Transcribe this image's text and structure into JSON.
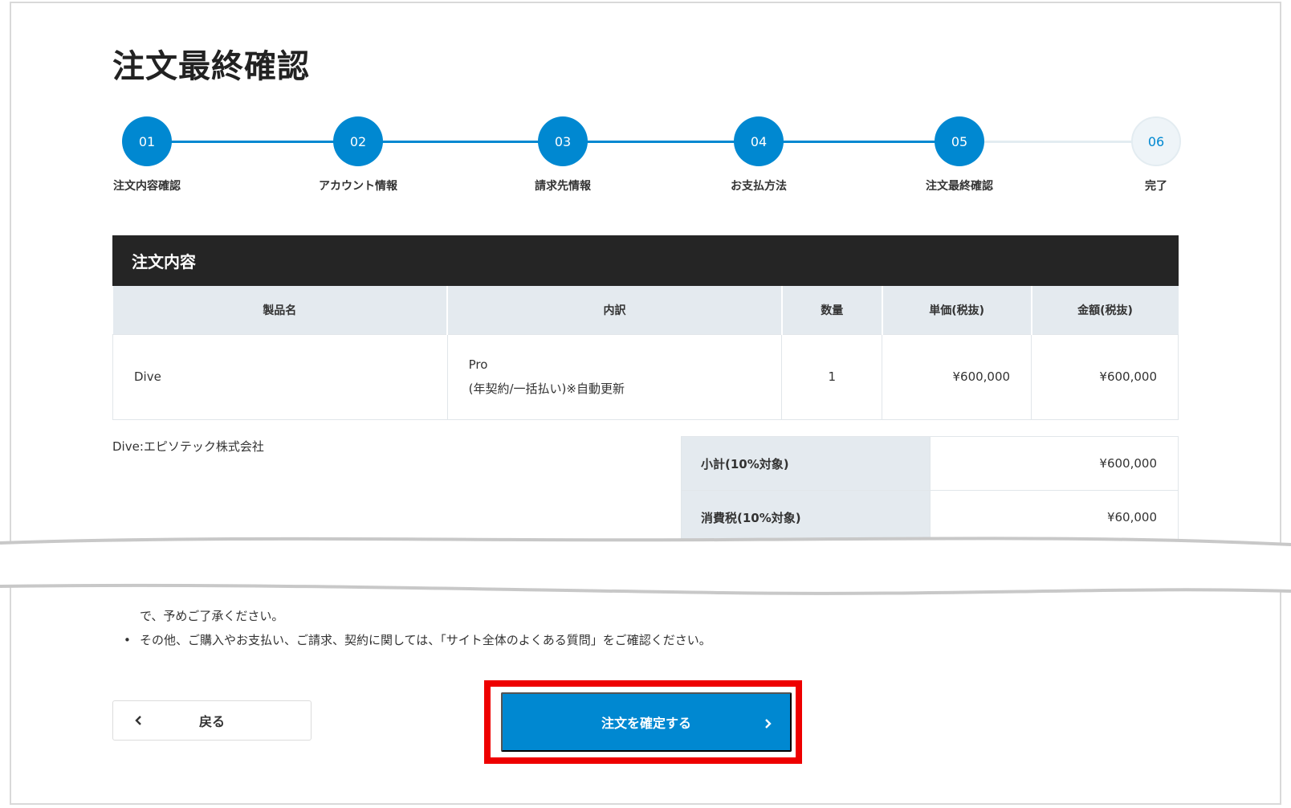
{
  "page": {
    "title": "注文最終確認"
  },
  "steps": [
    {
      "num": "01",
      "label": "注文内容確認",
      "state": "done"
    },
    {
      "num": "02",
      "label": "アカウント情報",
      "state": "done"
    },
    {
      "num": "03",
      "label": "請求先情報",
      "state": "done"
    },
    {
      "num": "04",
      "label": "お支払方法",
      "state": "done"
    },
    {
      "num": "05",
      "label": "注文最終確認",
      "state": "done"
    },
    {
      "num": "06",
      "label": "完了",
      "state": "todo"
    }
  ],
  "order": {
    "header": "注文内容",
    "columns": [
      "製品名",
      "内訳",
      "数量",
      "単価(税抜)",
      "金額(税抜)"
    ],
    "rows": [
      {
        "product": "Dive",
        "detail_line1": "Pro",
        "detail_line2": "(年契約/一括払い)※自動更新",
        "qty": "1",
        "unit_price": "¥600,000",
        "amount": "¥600,000"
      }
    ]
  },
  "vendor_note": "Dive:エピソテック株式会社",
  "summary": [
    {
      "label": "小計(10%対象)",
      "value": "¥600,000"
    },
    {
      "label": "消費税(10%対象)",
      "value": "¥60,000"
    }
  ],
  "notes": {
    "line1_cont": "で、予めご了承ください。",
    "line2": "その他、ご購入やお支払い、ご請求、契約に関しては、「サイト全体のよくある質問」をご確認ください。"
  },
  "buttons": {
    "back": "戻る",
    "confirm": "注文を確定する"
  },
  "colors": {
    "accent": "#0088d1",
    "header_bg": "#252525",
    "table_head_bg": "#e4eaef",
    "highlight": "#ee0000"
  }
}
